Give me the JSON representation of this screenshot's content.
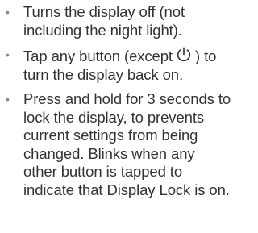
{
  "items": [
    {
      "text": "Turns the display off (not including the night light)."
    },
    {
      "text_before": "Tap any button (except",
      "icon": "power-icon",
      "text_after": ") to turn the display back on."
    },
    {
      "text": "Press and hold for 3 seconds to lock the display, to prevents current settings from being changed. Blinks when any other button is tapped to indicate that Display Lock is on."
    }
  ],
  "bullet_color": "#8a8a8a",
  "text_color": "#333333"
}
